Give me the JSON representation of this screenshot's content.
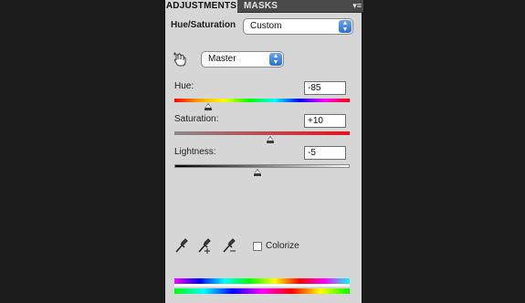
{
  "tabs": {
    "adjustments": "ADJUSTMENTS",
    "masks": "MASKS"
  },
  "panel_menu_icon": "panel-menu-icon",
  "preset": {
    "label": "Hue/Saturation",
    "value": "Custom"
  },
  "channel": {
    "value": "Master",
    "icon": "hand-adjust-icon"
  },
  "hue": {
    "label": "Hue:",
    "value": "-85",
    "slider_fraction": 0.2
  },
  "saturation": {
    "label": "Saturation:",
    "value": "+10",
    "slider_fraction": 0.55
  },
  "lightness": {
    "label": "Lightness:",
    "value": "-5",
    "slider_fraction": 0.5
  },
  "tools": {
    "eyedropper": "eyedropper-icon",
    "eyedropper_add": "eyedropper-plus-icon",
    "eyedropper_subtract": "eyedropper-minus-icon"
  },
  "colorize": {
    "label": "Colorize",
    "checked": false
  },
  "colors": {
    "panel_bg": "#d6d6d6",
    "page_bg": "#1b1b1b",
    "dropdown_accent": "#2b6fd6"
  }
}
